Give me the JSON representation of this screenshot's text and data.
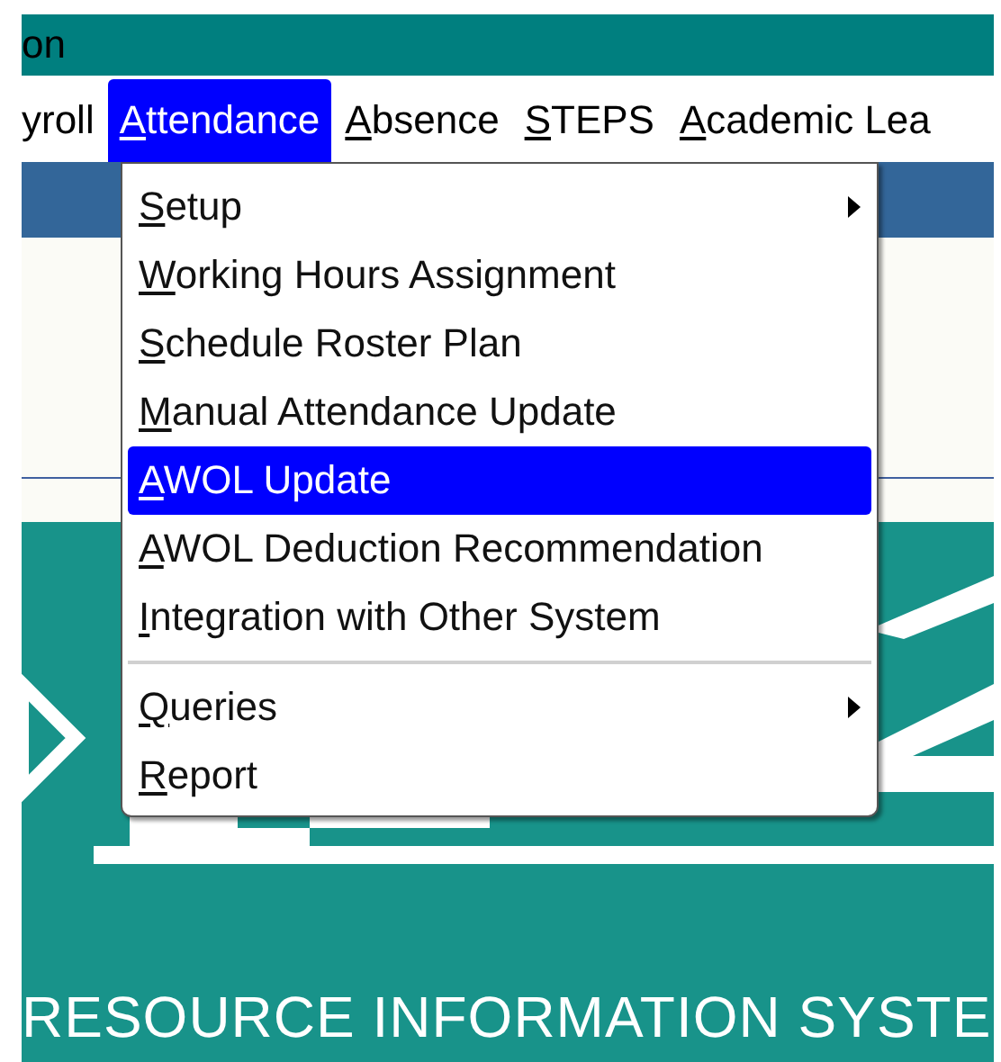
{
  "window": {
    "title": "on"
  },
  "menubar": [
    {
      "rest": "yroll",
      "selected": false
    },
    {
      "mnemonic": "A",
      "rest": "ttendance",
      "selected": true
    },
    {
      "mnemonic": "A",
      "rest": "bsence",
      "selected": false
    },
    {
      "mnemonic": "S",
      "rest": "TEPS",
      "selected": false
    },
    {
      "mnemonic": "A",
      "rest": "cademic Lea",
      "selected": false
    }
  ],
  "dropdown": {
    "groups": [
      [
        {
          "kind": "submenu",
          "mnemonic": "S",
          "rest": "etup",
          "selected": false
        },
        {
          "kind": "command",
          "mnemonic": "W",
          "rest": "orking Hours Assignment",
          "selected": false
        },
        {
          "kind": "command",
          "mnemonic": "S",
          "rest": "chedule Roster Plan",
          "selected": false
        },
        {
          "kind": "command",
          "mnemonic": "M",
          "rest": "anual Attendance Update",
          "selected": false
        },
        {
          "kind": "command",
          "mnemonic": "A",
          "rest": "WOL Update",
          "selected": true
        },
        {
          "kind": "command",
          "mnemonic": "A",
          "rest": "WOL Deduction Recommendation",
          "selected": false
        },
        {
          "kind": "command",
          "mnemonic": "I",
          "rest": "ntegration with Other System",
          "selected": false
        }
      ],
      [
        {
          "kind": "submenu",
          "mnemonic": "Q",
          "rest": "ueries",
          "selected": false
        },
        {
          "kind": "command",
          "mnemonic": "R",
          "rest": "eport",
          "selected": false
        }
      ]
    ]
  },
  "banner": {
    "caption": "RESOURCE INFORMATION SYSTE"
  }
}
